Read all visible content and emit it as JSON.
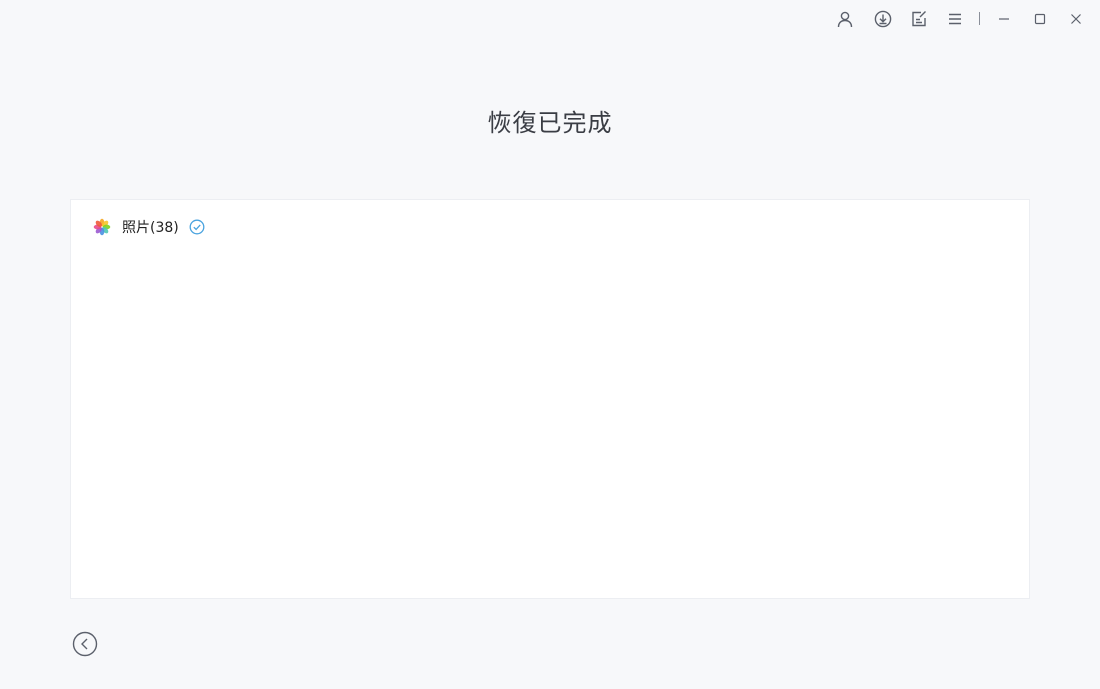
{
  "window": {
    "icons": [
      "user-icon",
      "download-icon",
      "feedback-icon",
      "menu-icon",
      "minimize-icon",
      "maximize-icon",
      "close-icon"
    ]
  },
  "page": {
    "title": "恢復已完成"
  },
  "results": [
    {
      "label": "照片(38)",
      "icon": "photos-app-icon",
      "status": "completed"
    }
  ],
  "colors": {
    "background": "#f7f8fa",
    "panel": "#ffffff",
    "check": "#4aa3df",
    "icon_stroke": "#5b606b"
  }
}
